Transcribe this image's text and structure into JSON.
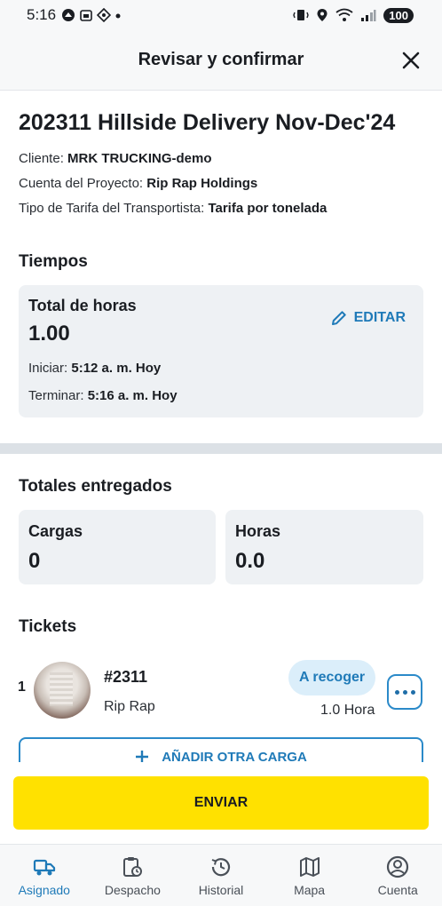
{
  "status_bar": {
    "time": "5:16",
    "battery": "100"
  },
  "header": {
    "title": "Revisar y confirmar"
  },
  "job": {
    "title": "202311 Hillside Delivery Nov-Dec'24",
    "client_label": "Cliente: ",
    "client_value": "MRK TRUCKING-demo",
    "project_label": "Cuenta del Proyecto: ",
    "project_value": "Rip Rap Holdings",
    "rate_label": "Tipo de Tarifa del Transportista: ",
    "rate_value": "Tarifa por tonelada"
  },
  "times": {
    "section_title": "Tiempos",
    "total_label": "Total de horas",
    "total_value": "1.00",
    "edit_label": "EDITAR",
    "start_label": "Iniciar: ",
    "start_value": "5:12 a. m. Hoy",
    "end_label": "Terminar: ",
    "end_value": "5:16 a. m. Hoy"
  },
  "totals": {
    "section_title": "Totales entregados",
    "loads_label": "Cargas",
    "loads_value": "0",
    "hours_label": "Horas",
    "hours_value": "0.0"
  },
  "tickets": {
    "section_title": "Tickets",
    "items": [
      {
        "index": "1",
        "number": "#2311",
        "material": "Rip Rap",
        "status": "A recoger",
        "hours": "1.0 Hora"
      }
    ],
    "add_label": "AÑADIR OTRA CARGA"
  },
  "actions": {
    "send_label": "ENVIAR"
  },
  "tabs": [
    {
      "label": "Asignado",
      "icon": "truck-icon",
      "active": true
    },
    {
      "label": "Despacho",
      "icon": "clipboard-clock-icon",
      "active": false
    },
    {
      "label": "Historial",
      "icon": "history-icon",
      "active": false
    },
    {
      "label": "Mapa",
      "icon": "map-icon",
      "active": false
    },
    {
      "label": "Cuenta",
      "icon": "account-icon",
      "active": false
    }
  ],
  "colors": {
    "accent": "#1f7ab8",
    "primary_button": "#ffe100",
    "card": "#eef1f4"
  }
}
